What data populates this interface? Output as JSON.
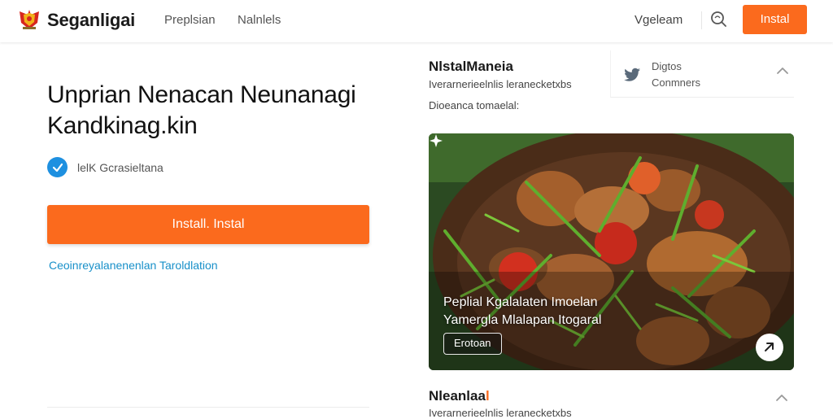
{
  "header": {
    "brand": "Seganligai",
    "nav": [
      "Preplsian",
      "Nalnlels"
    ],
    "right_link": "Vgeleam",
    "install_label": "Instal",
    "accent_color": "#fb6a1d"
  },
  "hero": {
    "headline_line1": "Unprian Nenacan Neunanagi",
    "headline_line2": "Kandkinag.kin",
    "check_label": "lelK Gcrasieltana",
    "install_button": "Install.  Instal",
    "info_link": "Ceoinreyalanenenlan Taroldlation"
  },
  "aside": {
    "title": "NlstalManeia",
    "line1": "Iverarnerieelnlis leranecketxbs",
    "line2": "Dioeanca tomaelal:",
    "twitter": {
      "icon": "twitter-icon",
      "line1": "Digtos",
      "line2": "Conmners"
    }
  },
  "feature_card": {
    "caption_line1": "Peplial Kgalalaten Imoelan",
    "caption_line2": "Yamergla Mlalapan Itogaral",
    "badge": "Erotoan"
  },
  "section2": {
    "title_main": "Nleanlaa",
    "title_accent": "l",
    "line": "Iverarnerieelnlis leranecketxbs"
  }
}
